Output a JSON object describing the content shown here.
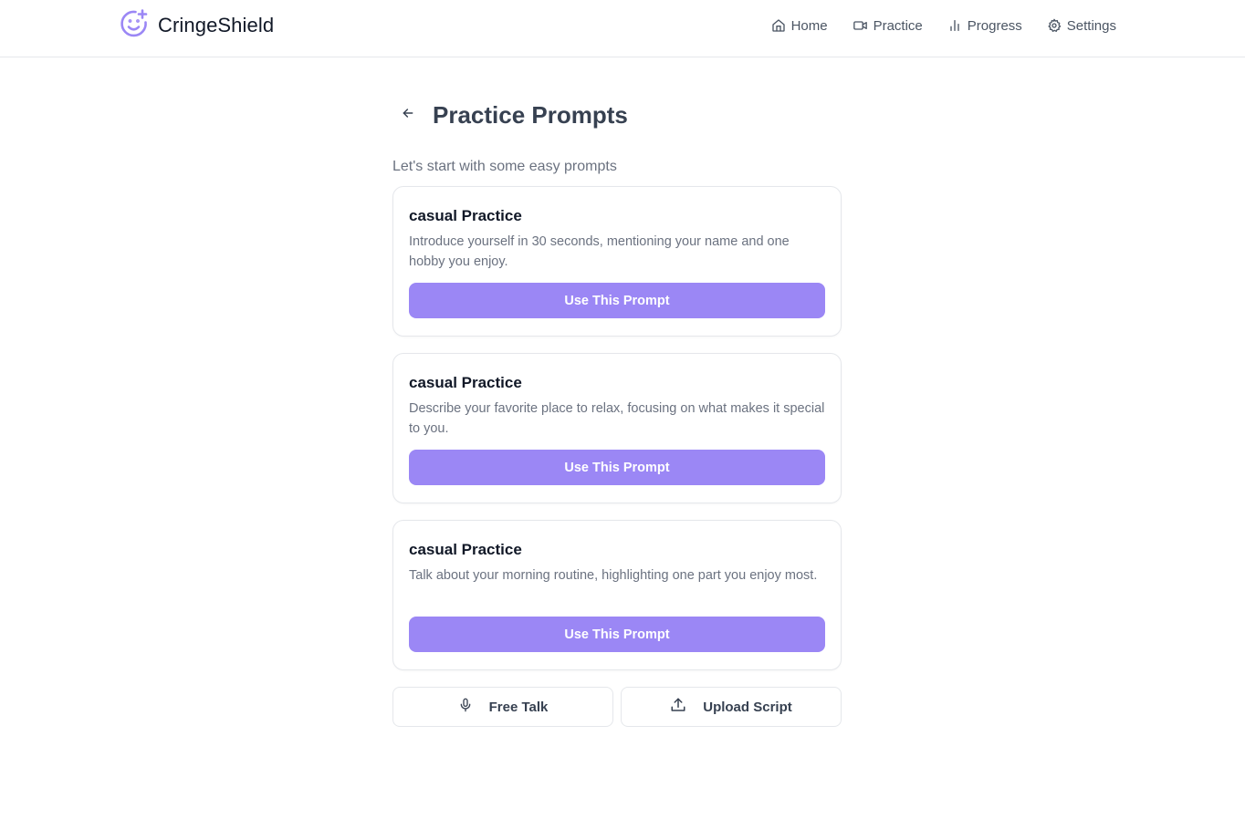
{
  "app": {
    "name": "CringeShield",
    "accent_color": "#9b87f5",
    "logo_icon": "smile-plus-icon"
  },
  "nav": {
    "items": [
      {
        "label": "Home",
        "icon": "home-icon"
      },
      {
        "label": "Practice",
        "icon": "video-icon"
      },
      {
        "label": "Progress",
        "icon": "bar-chart-icon"
      },
      {
        "label": "Settings",
        "icon": "gear-icon"
      }
    ]
  },
  "page": {
    "title": "Practice Prompts",
    "back_icon": "arrow-left-icon",
    "subtitle": "Let's start with some easy prompts"
  },
  "prompts": [
    {
      "category": "casual Practice",
      "text": "Introduce yourself in 30 seconds, mentioning your name and one hobby you enjoy.",
      "button": "Use This Prompt"
    },
    {
      "category": "casual Practice",
      "text": "Describe your favorite place to relax, focusing on what makes it special to you.",
      "button": "Use This Prompt"
    },
    {
      "category": "casual Practice",
      "text": "Talk about your morning routine, highlighting one part you enjoy most.",
      "button": "Use This Prompt"
    }
  ],
  "actions": {
    "free_talk": {
      "label": "Free Talk",
      "icon": "microphone-icon"
    },
    "upload_script": {
      "label": "Upload Script",
      "icon": "upload-icon"
    }
  }
}
